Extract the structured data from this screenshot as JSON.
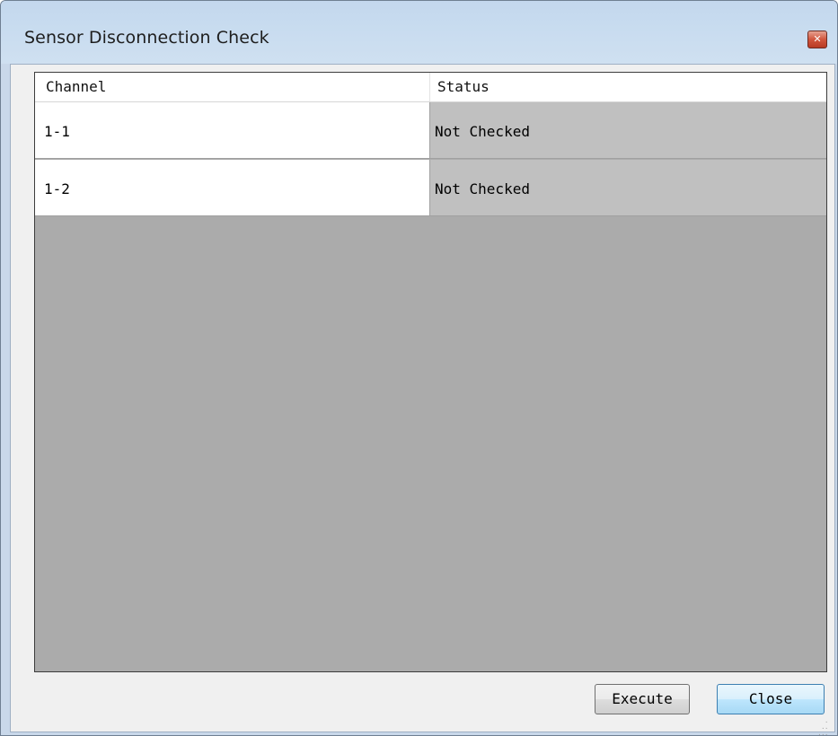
{
  "window": {
    "title": "Sensor Disconnection Check",
    "close_icon": "close-icon"
  },
  "table": {
    "columns": [
      "Channel",
      "Status"
    ],
    "rows": [
      {
        "channel": "1-1",
        "status": "Not Checked"
      },
      {
        "channel": "1-2",
        "status": "Not Checked"
      }
    ]
  },
  "buttons": {
    "execute_label": "Execute",
    "close_label": "Close"
  },
  "colors": {
    "status_cell_bg": "#c0c0c0",
    "grid_empty_bg": "#ababab",
    "titlebar": "#c7dbef"
  }
}
